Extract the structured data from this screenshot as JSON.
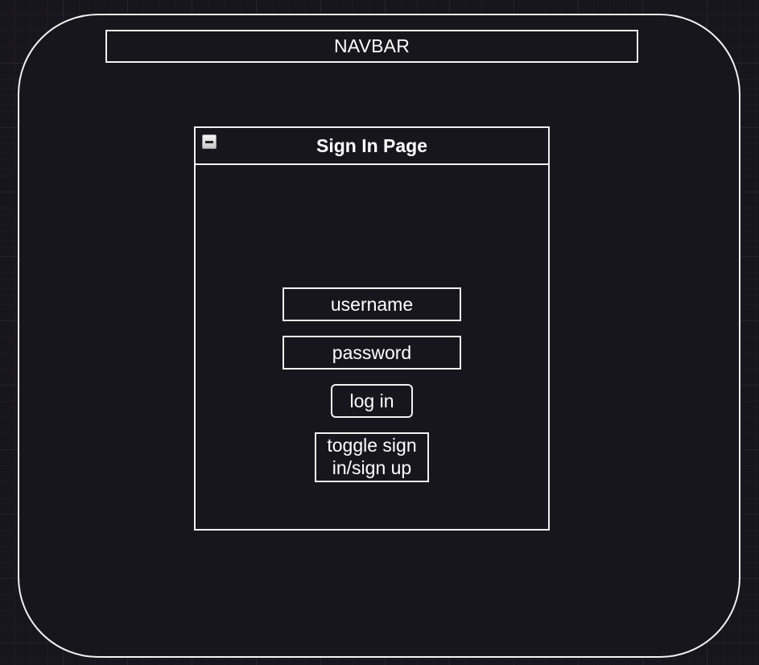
{
  "navbar": {
    "label": "NAVBAR"
  },
  "panel": {
    "title": "Sign In Page",
    "collapse_icon": "minus-icon"
  },
  "form": {
    "username_label": "username",
    "password_label": "password",
    "login_label": "log in",
    "toggle_label": "toggle sign in/sign up"
  },
  "colors": {
    "background": "#18161d",
    "stroke": "#f2f2f2",
    "text": "#ffffff"
  }
}
